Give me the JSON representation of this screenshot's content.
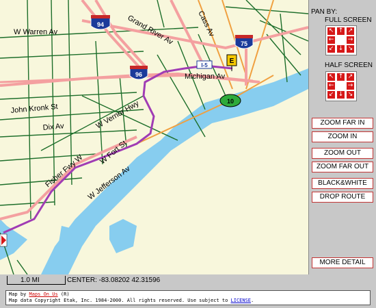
{
  "map": {
    "roads": {
      "w_warren": "W Warren Av",
      "grand_river": "Grand River Av",
      "cass": "Cass Av",
      "michigan": "Michigan Av",
      "john_kronk": "John Kronk St",
      "w_vernor": "W Vernor Hwy",
      "dix": "Dix Av",
      "fisher": "Fisher Fwy W",
      "w_fort": "W Fort St",
      "w_jefferson": "W Jefferson Av"
    },
    "shields": {
      "i94": "94",
      "i96": "96",
      "i75": "75",
      "route10": "10",
      "i45": "I-5",
      "exit": "E"
    },
    "colors": {
      "water": "#87cdef",
      "land": "#f8f7dc",
      "highway": "#f4a0a0",
      "route": "#a03cb4",
      "arterial": "#f0a040"
    }
  },
  "panel": {
    "pan_by": "PAN BY:",
    "full_screen": "FULL SCREEN",
    "half_screen": "HALF SCREEN",
    "buttons": {
      "zoom_far_in": "ZOOM FAR IN",
      "zoom_in": "ZOOM IN",
      "zoom_out": "ZOOM OUT",
      "zoom_far_out": "ZOOM FAR OUT",
      "black_white": "BLACK&WHITE",
      "drop_route": "DROP ROUTE",
      "more_detail": "MORE DETAIL"
    }
  },
  "footer": {
    "scale": "1.0 MI",
    "center": "CENTER: -83.08202 42.31596",
    "line1_prefix": "Map by ",
    "line1_link": "Maps On Us",
    "line1_suffix": " (R)",
    "line2_prefix": "Map data Copyright Etak, Inc. 1984-2000. All rights reserved. Use subject to ",
    "line2_link": "LICENSE",
    "line2_suffix": "."
  }
}
